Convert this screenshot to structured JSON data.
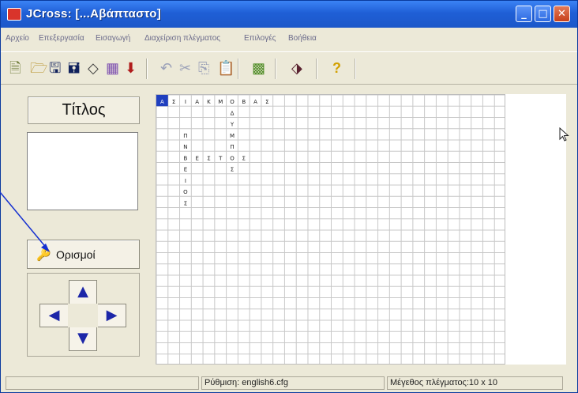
{
  "window": {
    "title": "JCross: [...Αβάπταστο]",
    "controls": {
      "minimize": "_",
      "maximize": "□",
      "close": "✕"
    }
  },
  "menu": {
    "items": [
      "Αρχείο",
      "Επεξεργασία",
      "Εισαγωγή",
      "Διαχείριση πλέγματος",
      "Επιλογές",
      "Βοήθεια"
    ]
  },
  "toolbar": {
    "icons": [
      "new-icon",
      "open-icon",
      "save-icon",
      "save-as-icon",
      "clear-icon",
      "grid-icon",
      "insert-icon",
      "undo-icon",
      "cut-icon",
      "copy-icon",
      "paste-icon",
      "automatic-grid-icon",
      "export-icon",
      "help-icon"
    ]
  },
  "left_panel": {
    "title_button": "Τίτλος",
    "title_text": "",
    "definitions_button": "Ορισμοί"
  },
  "arrows": {
    "up": "▲",
    "left": "◀",
    "right": "▶",
    "down": "▼"
  },
  "grid": {
    "cols": 30,
    "rows": 24,
    "words": [
      {
        "row": 0,
        "col": 0,
        "dir": "across",
        "text": "ΑΣΙΑΚΜΟΒΑΣ"
      },
      {
        "row": 0,
        "col": 6,
        "dir": "down",
        "text": "ΟΔΥΜΠΟΣ"
      },
      {
        "row": 3,
        "col": 2,
        "dir": "down",
        "text": "ΠΝΒΕΙΟΣ"
      },
      {
        "row": 5,
        "col": 2,
        "dir": "across",
        "text": "ΒΕΣΤΟΣ"
      }
    ],
    "highlight_cell": {
      "row": 0,
      "col": 0
    },
    "highlight_color": "#1f3fbf"
  },
  "status": {
    "setting": "Ρύθμιση: english6.cfg",
    "grid_size": "Μέγεθος πλέγματος:10 x 10"
  },
  "colors": {
    "title_bar": "#1f5fd6",
    "arrow": "#1c26a8",
    "pointer_line": "#1530d0"
  }
}
